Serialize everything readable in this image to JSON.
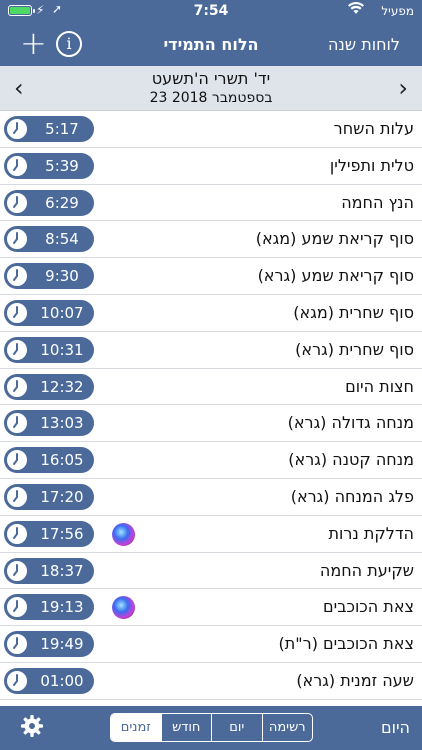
{
  "status_bar": {
    "time": "7:54",
    "carrier": "מפעיל"
  },
  "nav": {
    "title": "הלוח התמידי",
    "tables_label": "לוחות שנה",
    "add_icon": "plus-icon",
    "info_icon": "info-icon"
  },
  "date_header": {
    "hebrew_date": "יד' תשרי ה'תשעט",
    "gregorian_date": "23 בספטמבר 2018"
  },
  "rows": [
    {
      "label": "עלות השחר",
      "time": "5:17",
      "siri": false
    },
    {
      "label": "טלית ותפילין",
      "time": "5:39",
      "siri": false
    },
    {
      "label": "הנץ החמה",
      "time": "6:29",
      "siri": false
    },
    {
      "label": "סוף קריאת שמע (מגא)",
      "time": "8:54",
      "siri": false
    },
    {
      "label": "סוף קריאת שמע (גרא)",
      "time": "9:30",
      "siri": false
    },
    {
      "label": "סוף שחרית (מגא)",
      "time": "10:07",
      "siri": false
    },
    {
      "label": "סוף שחרית (גרא)",
      "time": "10:31",
      "siri": false
    },
    {
      "label": "חצות היום",
      "time": "12:32",
      "siri": false
    },
    {
      "label": "מנחה גדולה (גרא)",
      "time": "13:03",
      "siri": false
    },
    {
      "label": "מנחה קטנה (גרא)",
      "time": "16:05",
      "siri": false
    },
    {
      "label": "פלג המנחה (גרא)",
      "time": "17:20",
      "siri": false
    },
    {
      "label": "הדלקת נרות",
      "time": "17:56",
      "siri": true
    },
    {
      "label": "שקיעת החמה",
      "time": "18:37",
      "siri": false
    },
    {
      "label": "צאת הכוכבים",
      "time": "19:13",
      "siri": true
    },
    {
      "label": "צאת הכוכבים (ר\"ת)",
      "time": "19:49",
      "siri": false
    },
    {
      "label": "שעה זמנית (גרא)",
      "time": "01:00",
      "siri": false
    }
  ],
  "toolbar": {
    "segments": [
      "זמנים",
      "חודש",
      "יום",
      "רשימה"
    ],
    "active_segment": "זמנים",
    "today_label": "היום",
    "settings_icon": "gear-icon"
  },
  "colors": {
    "primary": "#4b6a9a",
    "header_bg": "#dfe3ea",
    "battery": "#4cd964"
  }
}
